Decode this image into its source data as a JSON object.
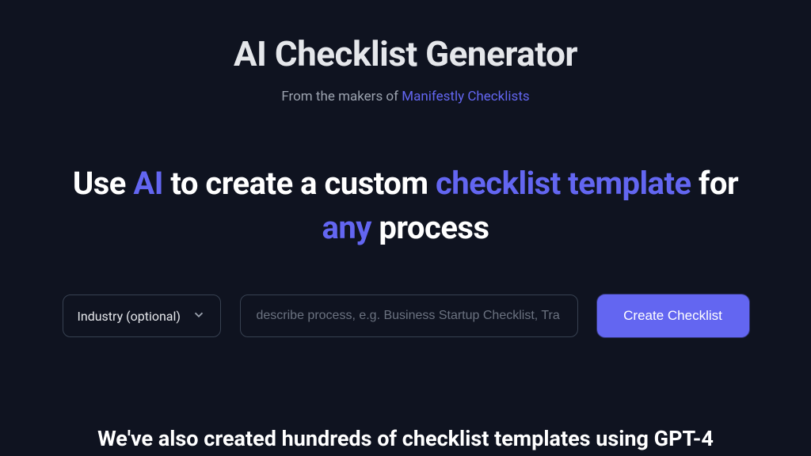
{
  "header": {
    "title": "AI Checklist Generator",
    "subtitle_prefix": "From the makers of ",
    "subtitle_link": "Manifestly Checklists"
  },
  "headline": {
    "p1": "Use ",
    "ai": "AI",
    "p2": " to create a custom ",
    "template": "checklist template",
    "p3": " for ",
    "any": "any",
    "p4": " process"
  },
  "form": {
    "industry_label": "Industry (optional)",
    "process_placeholder": "describe process, e.g. Business Startup Checklist, Tra",
    "create_button": "Create Checklist"
  },
  "footer": {
    "text": "We've also created hundreds of checklist templates using GPT-4"
  }
}
